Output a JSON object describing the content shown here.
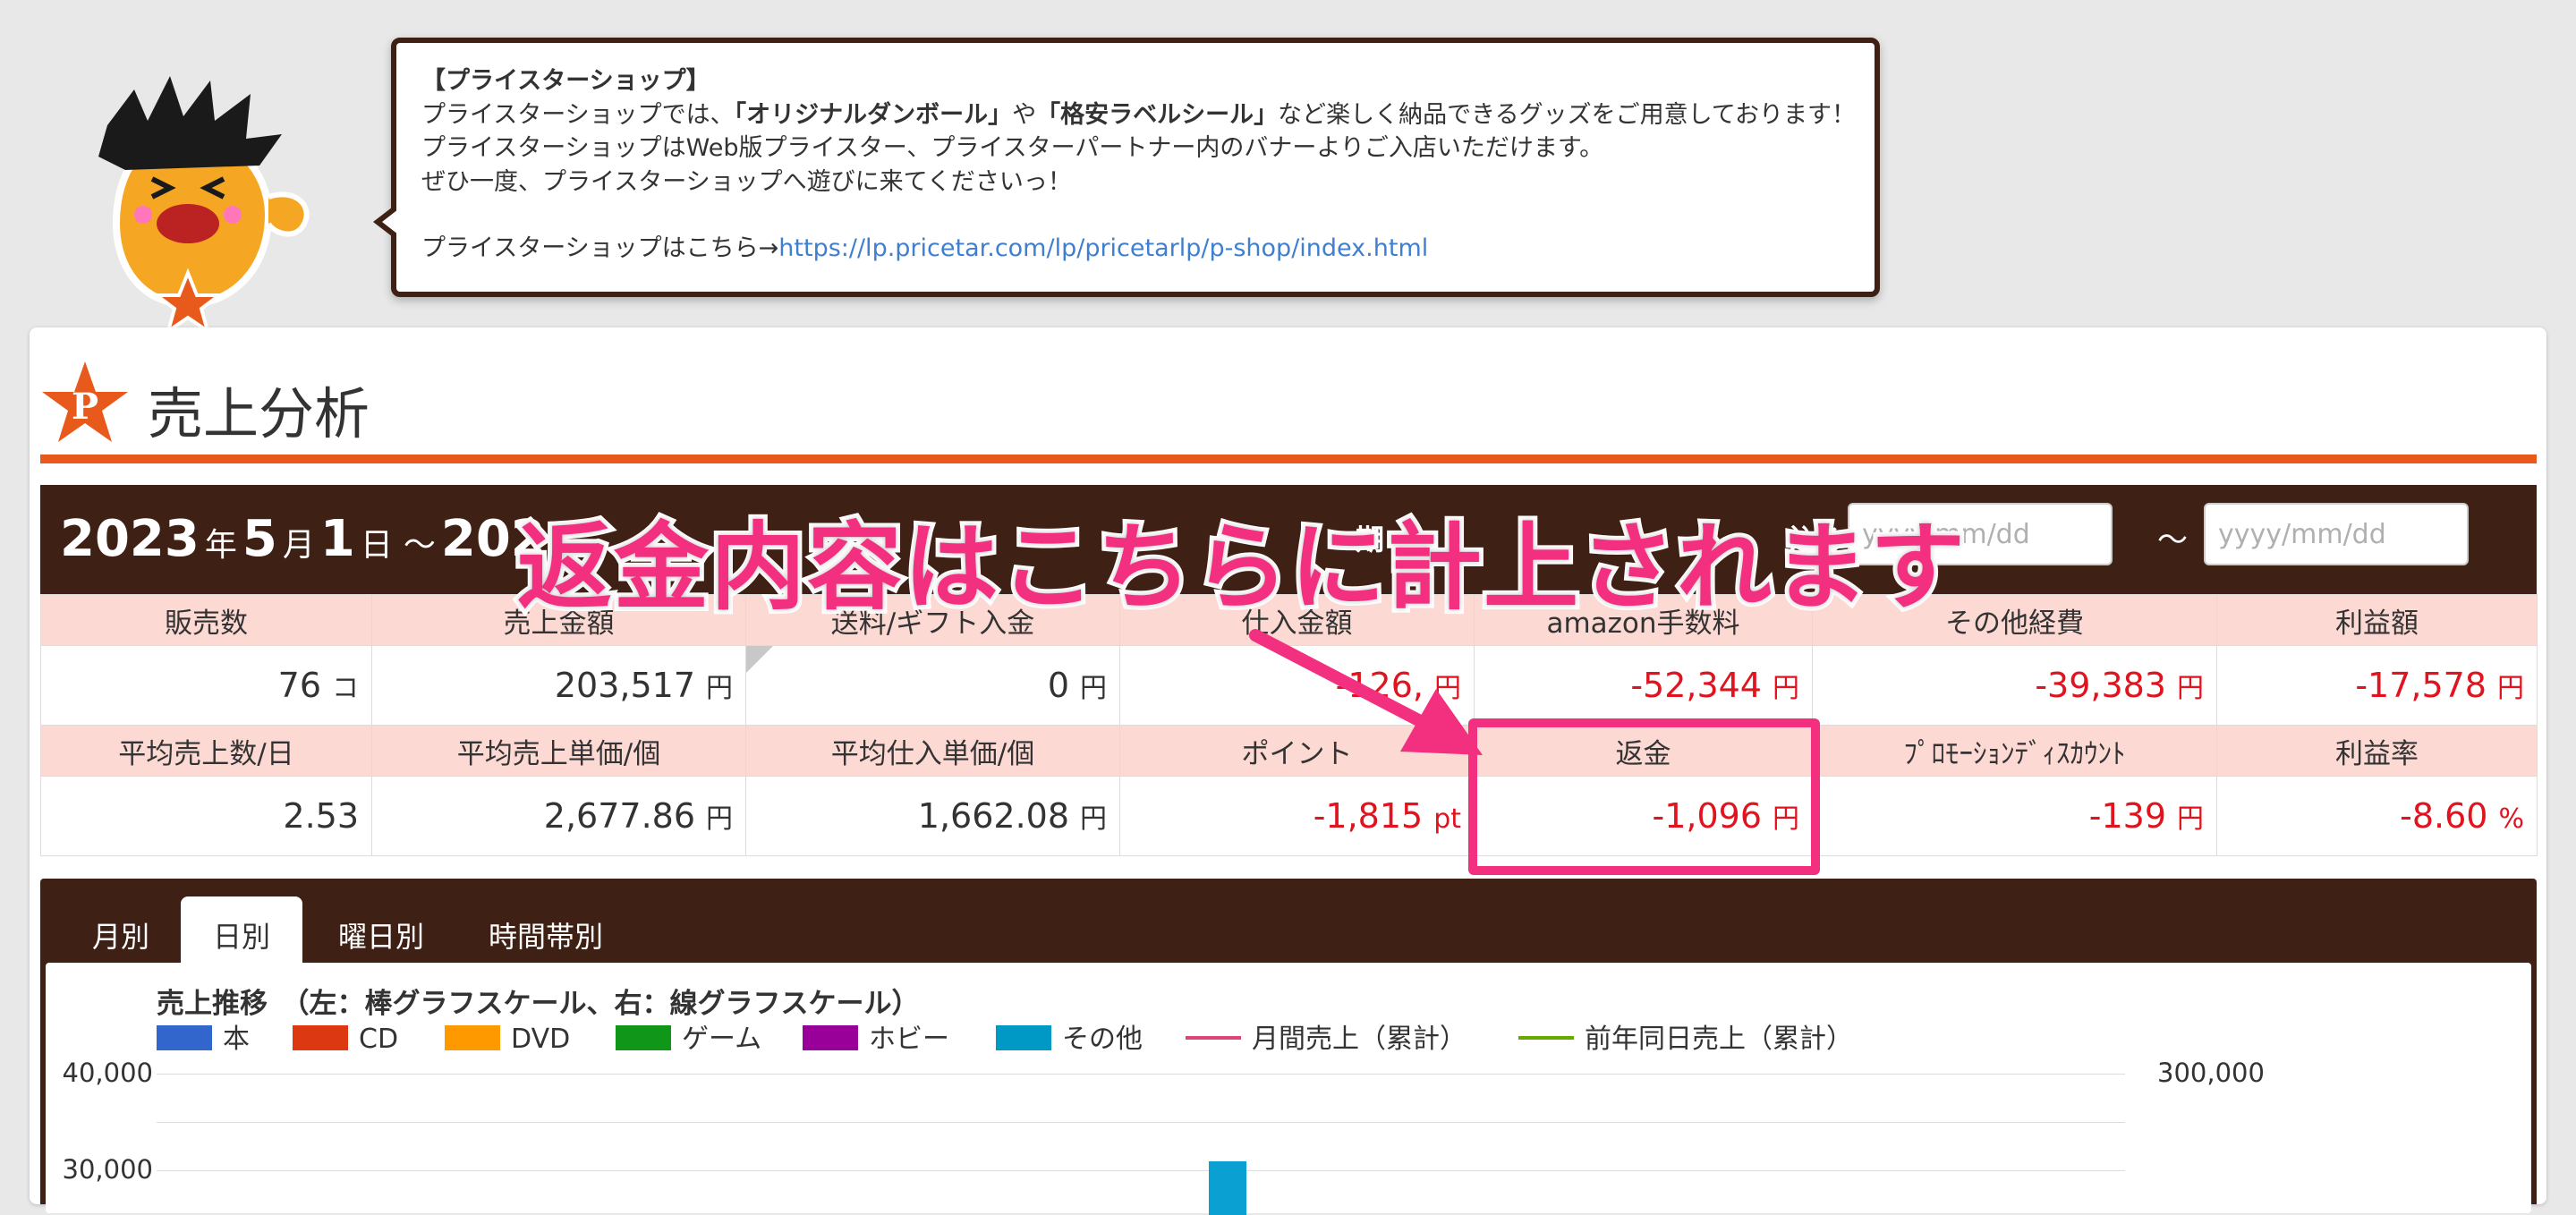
{
  "bubble": {
    "heading": "【プライスターショップ】",
    "line1_pre": "プライスターショップでは、",
    "line1_b1": "「オリジナルダンボール」",
    "line1_mid": "や",
    "line1_b2": "「格安ラベルシール」",
    "line1_post": "など楽しく納品できるグッズをご用意しております！",
    "line2": "プライスターショップはWeb版プライスター、プライスターパートナー内のバナーよりご入店いただけます。",
    "line3": "ぜひ一度、プライスターショップへ遊びに来てくださいっ！",
    "link_prefix": "プライスターショップはこちら→",
    "link_text": "https://lp.pricetar.com/lp/pricetarlp/p-shop/index.html"
  },
  "page": {
    "title": "売上分析",
    "logo_letter": "P"
  },
  "datebar": {
    "year": "2023",
    "year_unit": "年",
    "month": "5",
    "month_unit": "月",
    "day": "1",
    "day_unit": "日",
    "sep": "～",
    "end_partial": "202",
    "hidden_label": "期",
    "filter_label": "込み",
    "from_placeholder": "yyyy/mm/dd",
    "to_placeholder": "yyyy/mm/dd",
    "tilde": "～"
  },
  "stats": {
    "row1_headers": [
      "販売数",
      "売上金額",
      "送料/ギフト入金",
      "仕入金額",
      "amazon手数料",
      "その他経費",
      "利益額"
    ],
    "row1_values": [
      {
        "v": "76",
        "u": "コ",
        "neg": false
      },
      {
        "v": "203,517",
        "u": "円",
        "neg": false
      },
      {
        "v": "0",
        "u": "円",
        "neg": false
      },
      {
        "v": "-126,",
        "u": "円",
        "neg": true
      },
      {
        "v": "-52,344",
        "u": "円",
        "neg": true
      },
      {
        "v": "-39,383",
        "u": "円",
        "neg": true
      },
      {
        "v": "-17,578",
        "u": "円",
        "neg": true
      }
    ],
    "row2_headers": [
      "平均売上数/日",
      "平均売上単価/個",
      "平均仕入単価/個",
      "ポイント",
      "返金",
      "ﾌﾟﾛﾓｰｼｮﾝﾃﾞｨｽｶｳﾝﾄ",
      "利益率"
    ],
    "row2_values": [
      {
        "v": "2.53",
        "u": "",
        "neg": false
      },
      {
        "v": "2,677.86",
        "u": "円",
        "neg": false
      },
      {
        "v": "1,662.08",
        "u": "円",
        "neg": false
      },
      {
        "v": "-1,815",
        "u": "pt",
        "neg": true
      },
      {
        "v": "-1,096",
        "u": "円",
        "neg": true
      },
      {
        "v": "-139",
        "u": "円",
        "neg": true
      },
      {
        "v": "-8.60",
        "u": "%",
        "neg": true
      }
    ]
  },
  "tabs": [
    {
      "label": "月別",
      "active": false
    },
    {
      "label": "日別",
      "active": true
    },
    {
      "label": "曜日別",
      "active": false
    },
    {
      "label": "時間帯別",
      "active": false
    }
  ],
  "chart_data": {
    "type": "bar",
    "title": "売上推移　（左：棒グラフスケール、右：線グラフスケール）",
    "legend": [
      {
        "name": "本",
        "color": "#3366cc",
        "kind": "bar"
      },
      {
        "name": "CD",
        "color": "#dc3912",
        "kind": "bar"
      },
      {
        "name": "DVD",
        "color": "#ff9900",
        "kind": "bar"
      },
      {
        "name": "ゲーム",
        "color": "#109618",
        "kind": "bar"
      },
      {
        "name": "ホビー",
        "color": "#990099",
        "kind": "bar"
      },
      {
        "name": "その他",
        "color": "#0099c6",
        "kind": "bar"
      },
      {
        "name": "月間売上（累計）",
        "color": "#dd4477",
        "kind": "line"
      },
      {
        "name": "前年同日売上（累計）",
        "color": "#66aa00",
        "kind": "line"
      }
    ],
    "y_left_ticks": [
      "40,000",
      "30,000"
    ],
    "y_right_ticks": [
      "300,000"
    ],
    "legend_position": "top"
  },
  "overlay": {
    "annotation": "返金内容はこちらに計上されます",
    "color": "#f2307f"
  }
}
